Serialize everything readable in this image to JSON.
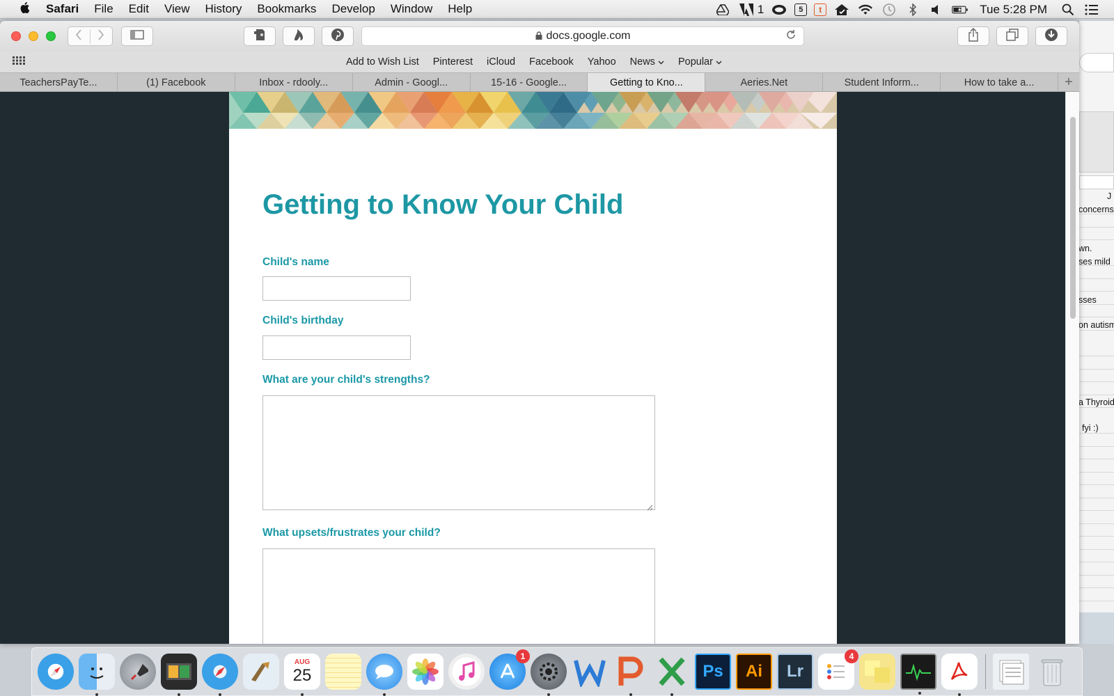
{
  "menubar": {
    "app_name": "Safari",
    "items": [
      "File",
      "Edit",
      "View",
      "History",
      "Bookmarks",
      "Develop",
      "Window",
      "Help"
    ],
    "status": {
      "adobe_count": "1",
      "clock": "Tue 5:28 PM"
    }
  },
  "browser": {
    "url": "docs.google.com",
    "favorites": [
      "Add to Wish List",
      "Pinterest",
      "iCloud",
      "Facebook",
      "Yahoo",
      "News",
      "Popular"
    ],
    "tabs": [
      {
        "label": "TeachersPayTe...",
        "active": false
      },
      {
        "label": "(1) Facebook",
        "active": false
      },
      {
        "label": "Inbox - rdooly...",
        "active": false
      },
      {
        "label": "Admin - Googl...",
        "active": false
      },
      {
        "label": "15-16 - Google...",
        "active": false
      },
      {
        "label": "Getting to Kno...",
        "active": true
      },
      {
        "label": "Aeries.Net",
        "active": false
      },
      {
        "label": "Student Inform...",
        "active": false
      },
      {
        "label": "How to take a...",
        "active": false
      }
    ]
  },
  "form": {
    "title": "Getting to Know Your Child",
    "accent_color": "#1a98a6",
    "fields": {
      "name_label": "Child's name",
      "name_value": "",
      "birthday_label": "Child's birthday",
      "birthday_value": "",
      "strengths_label": "What are your child's strengths?",
      "strengths_value": "",
      "frustrates_label": "What upsets/frustrates your child?",
      "frustrates_value": ""
    }
  },
  "background_sheet": {
    "cells": [
      "J",
      "concerns",
      "wn.",
      "ses mild",
      "sses",
      "on autism",
      "a Thyroid",
      "fyi :)"
    ]
  },
  "dock": {
    "badges": {
      "app_store": "1",
      "reminders": "4"
    },
    "calendar": {
      "month": "AUG",
      "day": "25"
    },
    "apps": [
      "Ps",
      "Ai",
      "Lr"
    ]
  }
}
